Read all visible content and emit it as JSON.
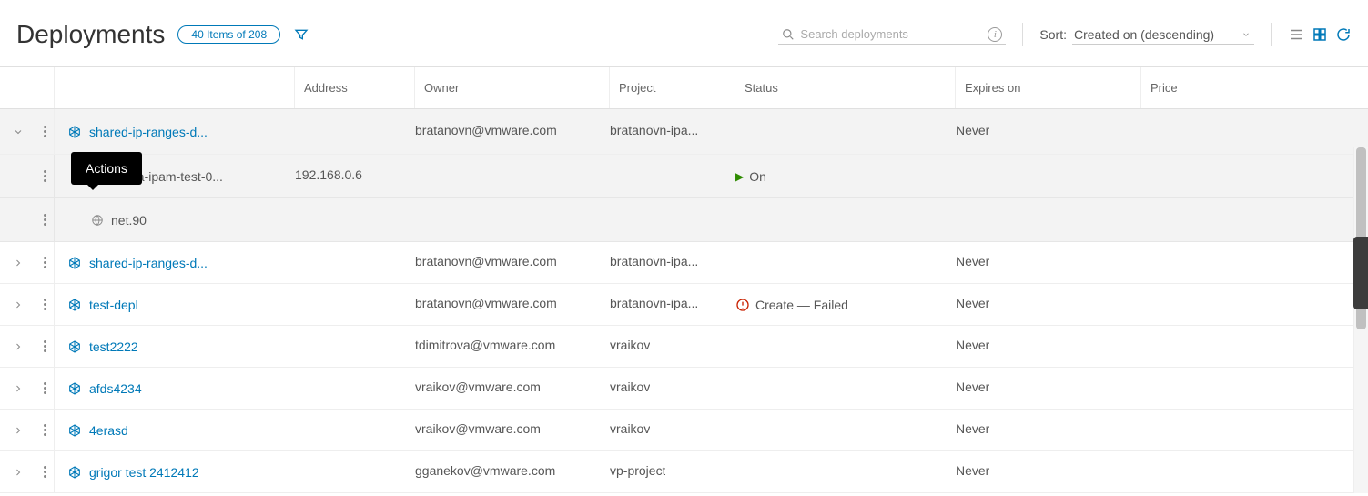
{
  "header": {
    "title": "Deployments",
    "item_count": "40 Items of 208",
    "search_placeholder": "Search deployments",
    "sort_label": "Sort:",
    "sort_value": "Created on (descending)"
  },
  "tooltip": {
    "actions": "Actions"
  },
  "columns": {
    "name": "",
    "address": "Address",
    "owner": "Owner",
    "project": "Project",
    "status": "Status",
    "expires": "Expires on",
    "price": "Price"
  },
  "rows": [
    {
      "type": "deployment",
      "expanded": true,
      "name": "shared-ip-ranges-d...",
      "address": "",
      "owner": "bratanovn@vmware.com",
      "project": "bratanovn-ipa...",
      "status": {
        "kind": "none",
        "text": ""
      },
      "expires": "Never",
      "price": "",
      "children": [
        {
          "icon": "vm",
          "name": "nikola-ipam-test-0...",
          "address": "192.168.0.6",
          "status": {
            "kind": "on",
            "text": "On"
          }
        },
        {
          "icon": "net",
          "name": "net.90",
          "address": "",
          "status": {
            "kind": "none",
            "text": ""
          }
        }
      ]
    },
    {
      "type": "deployment",
      "expanded": false,
      "name": "shared-ip-ranges-d...",
      "address": "",
      "owner": "bratanovn@vmware.com",
      "project": "bratanovn-ipa...",
      "status": {
        "kind": "none",
        "text": ""
      },
      "expires": "Never",
      "price": ""
    },
    {
      "type": "deployment",
      "expanded": false,
      "name": "test-depl",
      "address": "",
      "owner": "bratanovn@vmware.com",
      "project": "bratanovn-ipa...",
      "status": {
        "kind": "failed",
        "text": "Create — Failed"
      },
      "expires": "Never",
      "price": ""
    },
    {
      "type": "deployment",
      "expanded": false,
      "name": "test2222",
      "address": "",
      "owner": "tdimitrova@vmware.com",
      "project": "vraikov",
      "status": {
        "kind": "none",
        "text": ""
      },
      "expires": "Never",
      "price": ""
    },
    {
      "type": "deployment",
      "expanded": false,
      "name": "afds4234",
      "address": "",
      "owner": "vraikov@vmware.com",
      "project": "vraikov",
      "status": {
        "kind": "none",
        "text": ""
      },
      "expires": "Never",
      "price": ""
    },
    {
      "type": "deployment",
      "expanded": false,
      "name": "4erasd",
      "address": "",
      "owner": "vraikov@vmware.com",
      "project": "vraikov",
      "status": {
        "kind": "none",
        "text": ""
      },
      "expires": "Never",
      "price": ""
    },
    {
      "type": "deployment",
      "expanded": false,
      "name": "grigor test 2412412",
      "address": "",
      "owner": "gganekov@vmware.com",
      "project": "vp-project",
      "status": {
        "kind": "none",
        "text": ""
      },
      "expires": "Never",
      "price": ""
    }
  ]
}
